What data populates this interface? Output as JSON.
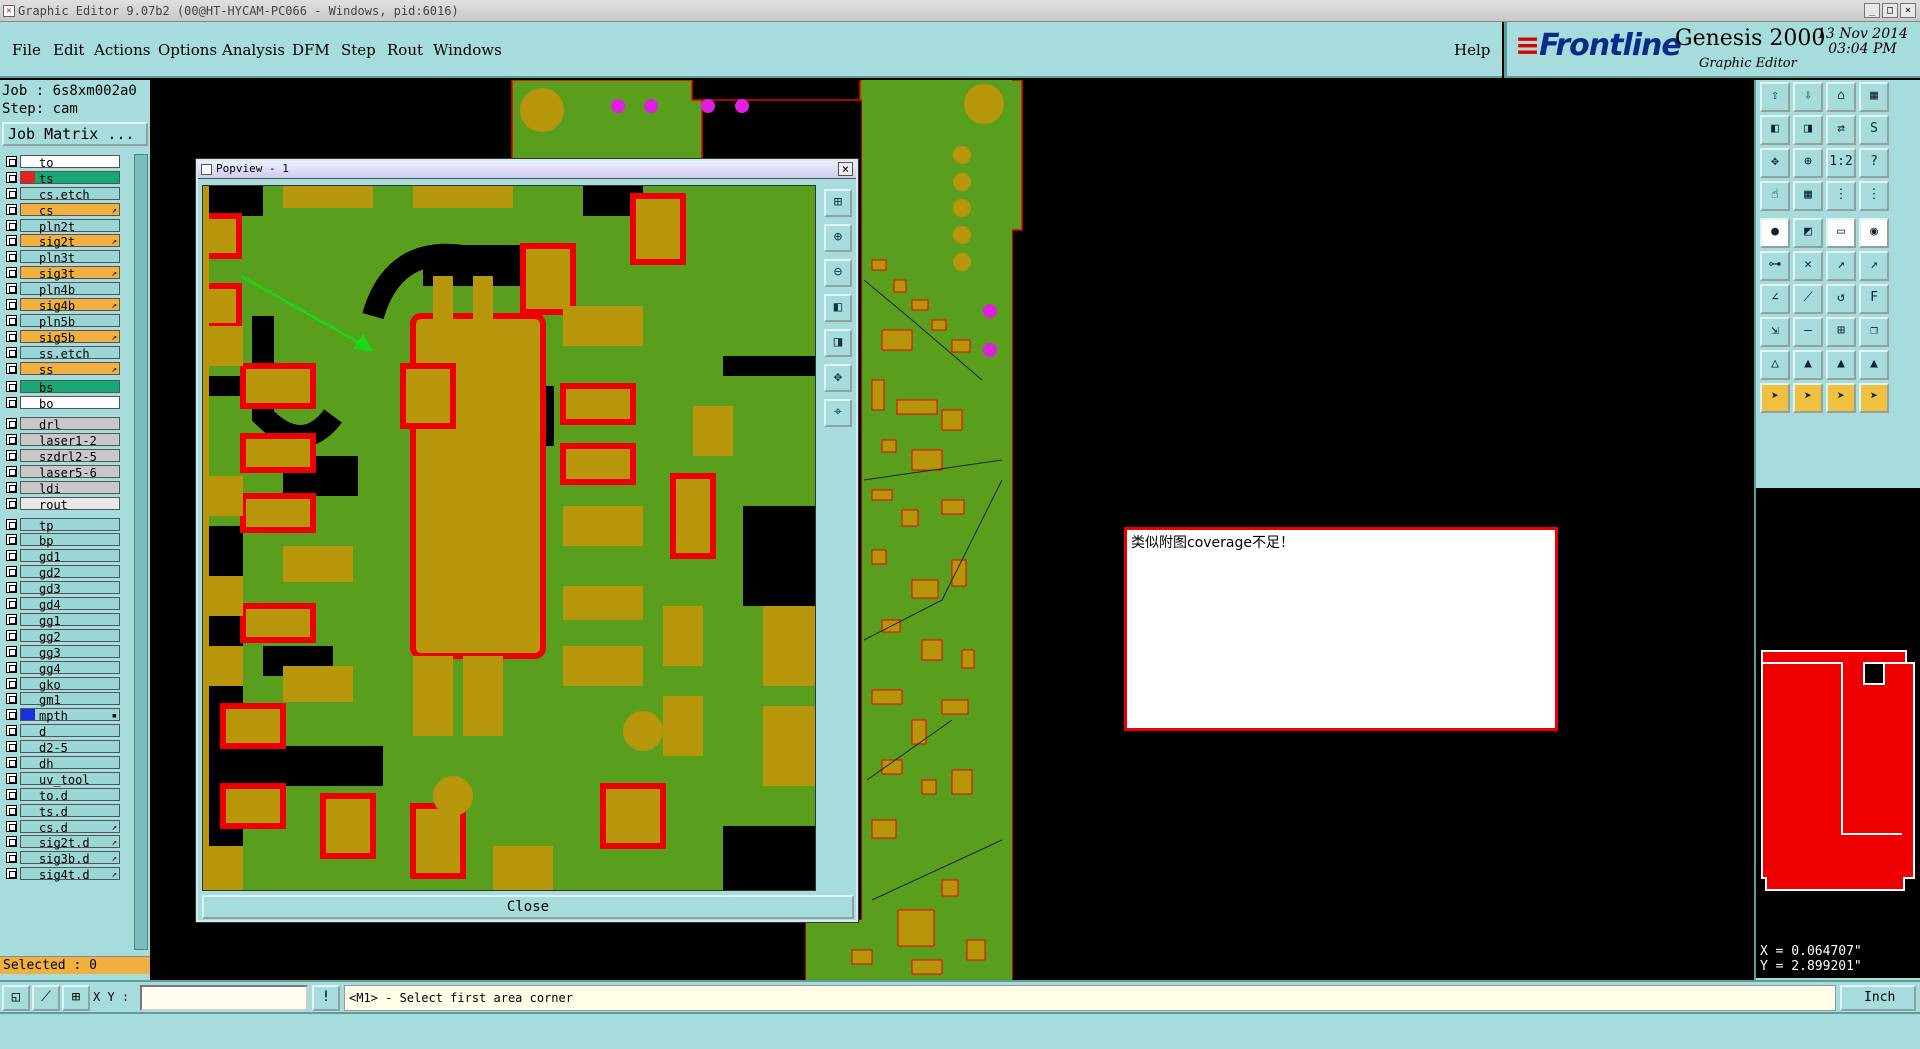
{
  "window": {
    "title": "Graphic Editor 9.07b2 (00@HT-HYCAM-PC066 - Windows, pid:6016)",
    "buttons": [
      "_",
      "□",
      "×"
    ]
  },
  "menu": {
    "items": [
      "File",
      "Edit",
      "Actions",
      "Options",
      "Analysis",
      "DFM",
      "Step",
      "Rout",
      "Windows"
    ],
    "help": "Help"
  },
  "brand": {
    "logo": "Frontline",
    "product": "Genesis 2000",
    "subtitle": "Graphic Editor",
    "date": "13 Nov 2014",
    "time": "03:04 PM"
  },
  "job": {
    "job_line": "Job : 6s8xm002a0",
    "step_line": "Step: cam",
    "matrix_button": "Job Matrix ..."
  },
  "layers": [
    {
      "name": "to",
      "color": "#ffffff",
      "mark": ""
    },
    {
      "name": "ts",
      "color": "#18a878",
      "mark": "",
      "swatch": "#e82020"
    },
    {
      "name": "cs.etch",
      "color": "#9ad6d6",
      "mark": ""
    },
    {
      "name": "cs",
      "color": "#f0b040",
      "mark": "↗"
    },
    {
      "name": "pln2t",
      "color": "#9ad6d6",
      "mark": ""
    },
    {
      "name": "sig2t",
      "color": "#f0b040",
      "mark": "↗"
    },
    {
      "name": "pln3t",
      "color": "#9ad6d6",
      "mark": ""
    },
    {
      "name": "sig3t",
      "color": "#f0b040",
      "mark": "↗"
    },
    {
      "name": "pln4b",
      "color": "#9ad6d6",
      "mark": ""
    },
    {
      "name": "sig4b",
      "color": "#f0b040",
      "mark": "↗"
    },
    {
      "name": "pln5b",
      "color": "#9ad6d6",
      "mark": ""
    },
    {
      "name": "sig5b",
      "color": "#f0b040",
      "mark": "↗"
    },
    {
      "name": "ss.etch",
      "color": "#9ad6d6",
      "mark": ""
    },
    {
      "name": "ss",
      "color": "#f0b040",
      "mark": "↗"
    },
    {
      "name": "bs",
      "color": "#18a878",
      "mark": ""
    },
    {
      "name": "bo",
      "color": "#ffffff",
      "mark": ""
    },
    {
      "name": "drl",
      "color": "#c8c8c8",
      "mark": ""
    },
    {
      "name": "laser1-2",
      "color": "#c8c8c8",
      "mark": ""
    },
    {
      "name": "szdrl2-5",
      "color": "#c8c8c8",
      "mark": ""
    },
    {
      "name": "laser5-6",
      "color": "#c8c8c8",
      "mark": ""
    },
    {
      "name": "ldi",
      "color": "#c8c8c8",
      "mark": ""
    },
    {
      "name": "rout",
      "color": "#e8e8e8",
      "mark": ""
    },
    {
      "name": "tp",
      "color": "#9ad6d6",
      "mark": ""
    },
    {
      "name": "bp",
      "color": "#9ad6d6",
      "mark": ""
    },
    {
      "name": "gd1",
      "color": "#9ad6d6",
      "mark": ""
    },
    {
      "name": "gd2",
      "color": "#9ad6d6",
      "mark": ""
    },
    {
      "name": "gd3",
      "color": "#9ad6d6",
      "mark": ""
    },
    {
      "name": "gd4",
      "color": "#9ad6d6",
      "mark": ""
    },
    {
      "name": "gg1",
      "color": "#9ad6d6",
      "mark": ""
    },
    {
      "name": "gg2",
      "color": "#9ad6d6",
      "mark": ""
    },
    {
      "name": "gg3",
      "color": "#9ad6d6",
      "mark": ""
    },
    {
      "name": "gg4",
      "color": "#9ad6d6",
      "mark": ""
    },
    {
      "name": "gko",
      "color": "#9ad6d6",
      "mark": ""
    },
    {
      "name": "gm1",
      "color": "#9ad6d6",
      "mark": ""
    },
    {
      "name": "mpth",
      "color": "#9ad6d6",
      "mark": "▪",
      "swatch": "#1830e0"
    },
    {
      "name": "d",
      "color": "#9ad6d6",
      "mark": ""
    },
    {
      "name": "d2-5",
      "color": "#9ad6d6",
      "mark": ""
    },
    {
      "name": "dh",
      "color": "#9ad6d6",
      "mark": ""
    },
    {
      "name": "uv_tool",
      "color": "#9ad6d6",
      "mark": ""
    },
    {
      "name": "to.d",
      "color": "#9ad6d6",
      "mark": ""
    },
    {
      "name": "ts.d",
      "color": "#9ad6d6",
      "mark": ""
    },
    {
      "name": "cs.d",
      "color": "#9ad6d6",
      "mark": "↗"
    },
    {
      "name": "sig2t.d",
      "color": "#9ad6d6",
      "mark": "↗"
    },
    {
      "name": "sig3b.d",
      "color": "#9ad6d6",
      "mark": "↗"
    },
    {
      "name": "sig4t.d",
      "color": "#9ad6d6",
      "mark": "↗"
    }
  ],
  "selected_text": "Selected : 0",
  "popview": {
    "title": "Popview - 1",
    "close_label": "Close",
    "tool_icons": [
      "zoom-home-icon",
      "zoom-in-icon",
      "zoom-out-icon",
      "pan-left-icon",
      "pan-right-icon",
      "fit-icon",
      "center-icon"
    ]
  },
  "note": {
    "text": "类似附图coverage不足！"
  },
  "coords": {
    "x": "X = 0.064707\"",
    "y": "Y = 2.899201\""
  },
  "status": {
    "xy_label": "X Y :",
    "xy_value": "",
    "message": "<M1> - Select first area corner",
    "unit": "Inch"
  },
  "colors": {
    "accent": "#a6dcdc",
    "copper": "#b8960c",
    "mask": "#5a9e1e",
    "annotation": "#e00000"
  }
}
